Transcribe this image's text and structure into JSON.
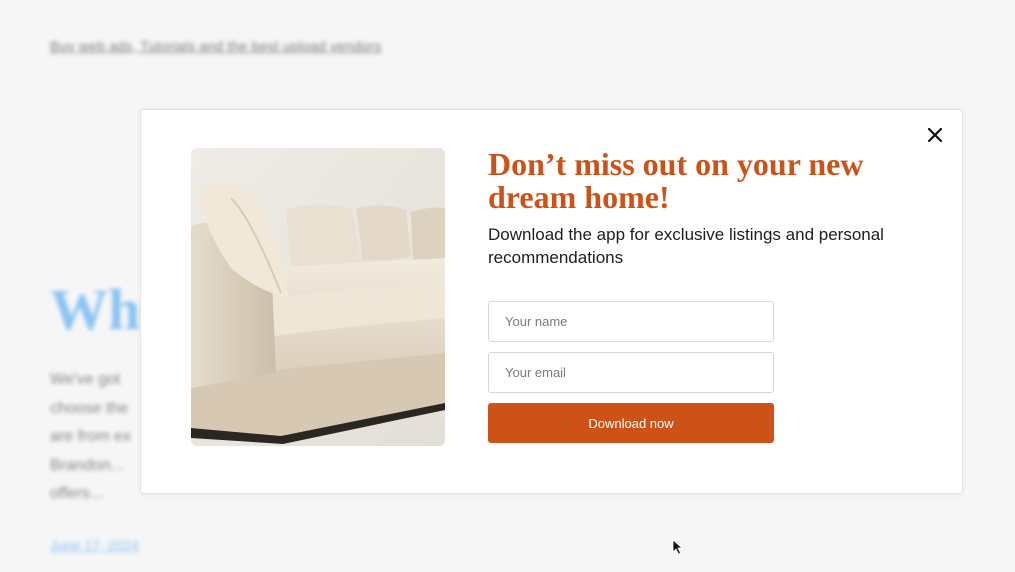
{
  "background": {
    "link_text": "Buy web ads, Tutorials and the best upload vendors",
    "heading": "Who",
    "paragraph": "We've got\nchoose the\nare from ex\nBrandon...\noffers...",
    "date": "June 17, 2024"
  },
  "modal": {
    "close_icon": "close-icon",
    "image_subject": "sofa-image",
    "headline": "Don’t miss out on your new dream home!",
    "subtext": "Download the app for exclusive listings and personal recommendations",
    "name_placeholder": "Your name",
    "email_placeholder": "Your email",
    "button_label": "Download now"
  },
  "colors": {
    "accent": "#cd5217",
    "background_link": "#4da3ee"
  }
}
